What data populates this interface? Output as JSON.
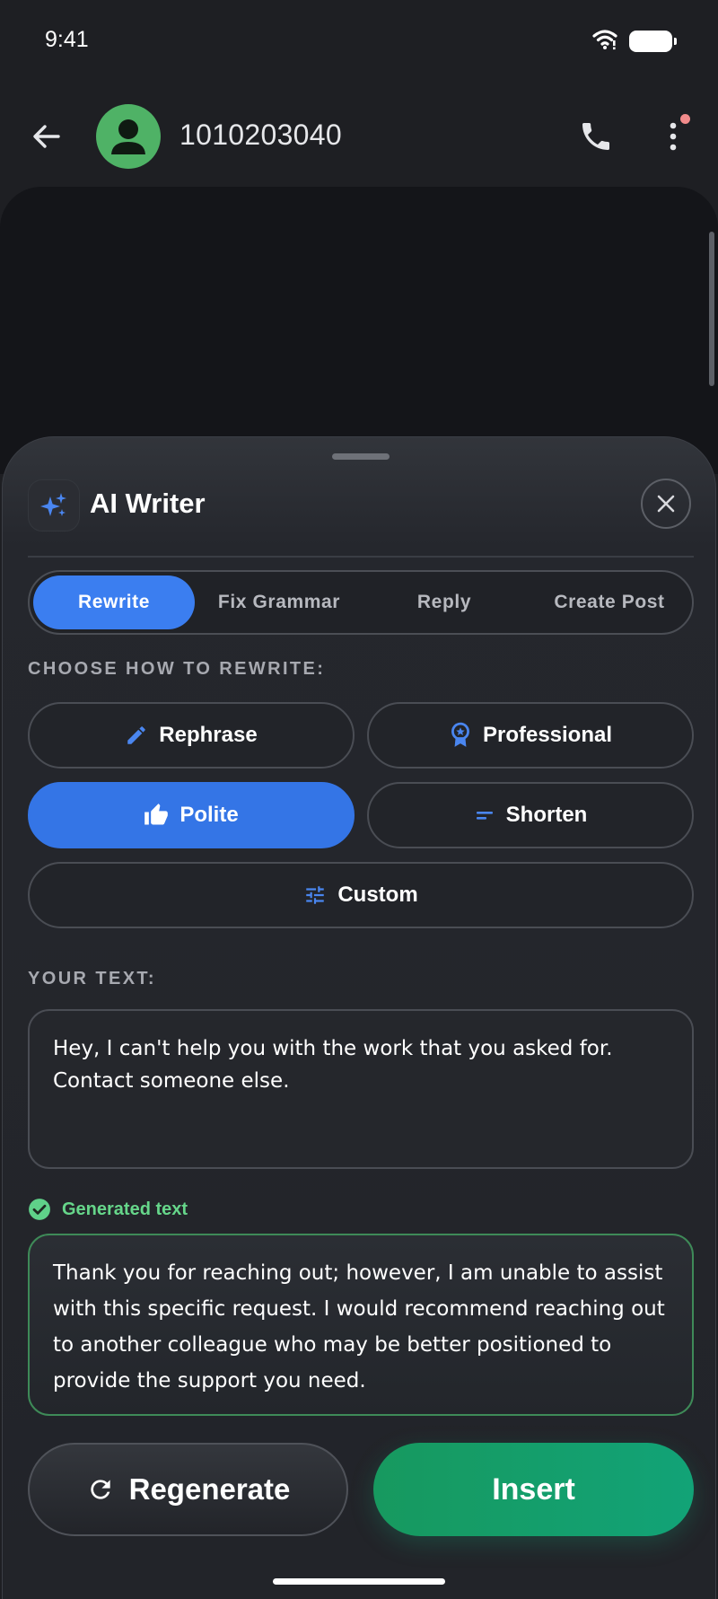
{
  "status_bar": {
    "time": "9:41"
  },
  "header": {
    "contact_number": "1010203040"
  },
  "sheet": {
    "title": "AI Writer",
    "tabs": [
      {
        "label": "Rewrite",
        "active": true
      },
      {
        "label": "Fix Grammar",
        "active": false
      },
      {
        "label": "Reply",
        "active": false
      },
      {
        "label": "Create Post",
        "active": false
      }
    ],
    "rewrite_section_label": "CHOOSE HOW TO REWRITE:",
    "options": [
      {
        "label": "Rephrase",
        "icon": "pencil-icon",
        "active": false
      },
      {
        "label": "Professional",
        "icon": "award-icon",
        "active": false
      },
      {
        "label": "Polite",
        "icon": "thumbs-up-icon",
        "active": true
      },
      {
        "label": "Shorten",
        "icon": "short-text-icon",
        "active": false
      },
      {
        "label": "Custom",
        "icon": "tune-icon",
        "active": false
      }
    ],
    "your_text_label": "YOUR TEXT:",
    "input_text_lines": [
      "Hey, I can't help you with the work that you asked for.",
      "Contact someone else."
    ],
    "generated_label": "Generated text",
    "generated_text_lines": [
      "Thank you for reaching out; however, I am unable to assist",
      "with this specific request. I would recommend reaching out",
      "to another colleague who may be better positioned to",
      "provide the support you need."
    ],
    "regenerate_label": "Regenerate",
    "insert_label": "Insert"
  },
  "colors": {
    "accent_blue": "#3b7ef0",
    "success_green": "#66d68a",
    "insert_green": "#12a377",
    "background": "#1e1f23"
  }
}
